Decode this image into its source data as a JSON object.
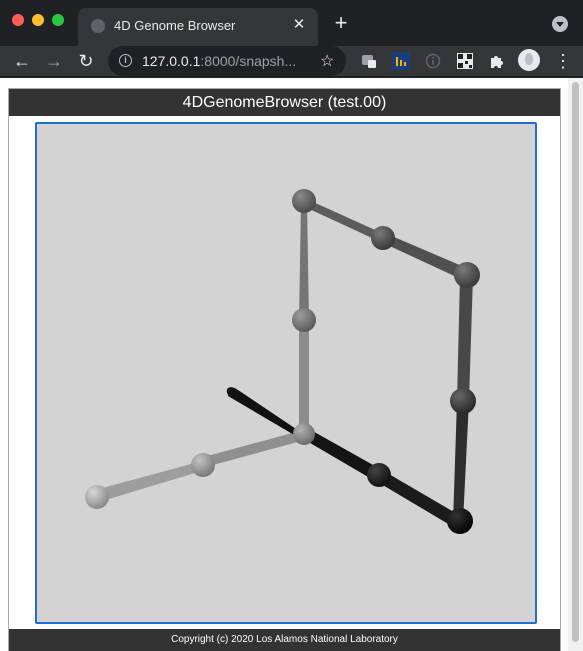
{
  "browser": {
    "tab_title": "4D Genome Browser",
    "tab_close_icon": "close-icon",
    "new_tab_icon": "plus-icon",
    "url_host": "127.0.0.1",
    "url_rest": ":8000/snapsh...",
    "extensions": [
      "extension-icon-1",
      "bar-chart-extension-icon",
      "info-extension-icon",
      "qr-code-extension-icon",
      "puzzle-icon"
    ]
  },
  "app": {
    "title": "4DGenomeBrowser (test.00)",
    "footer": "Copyright (c) 2020 Los Alamos National Laboratory"
  },
  "viewer": {
    "background": "#d3d3d3",
    "border_color": "#1f6fd1",
    "node_shades": [
      "#9a9a9a",
      "#8c8c8c",
      "#7f7f7f",
      "#6f6f6f",
      "#5f5f5f",
      "#4f4f4f",
      "#404040",
      "#2a2a2a",
      "#151515"
    ]
  }
}
